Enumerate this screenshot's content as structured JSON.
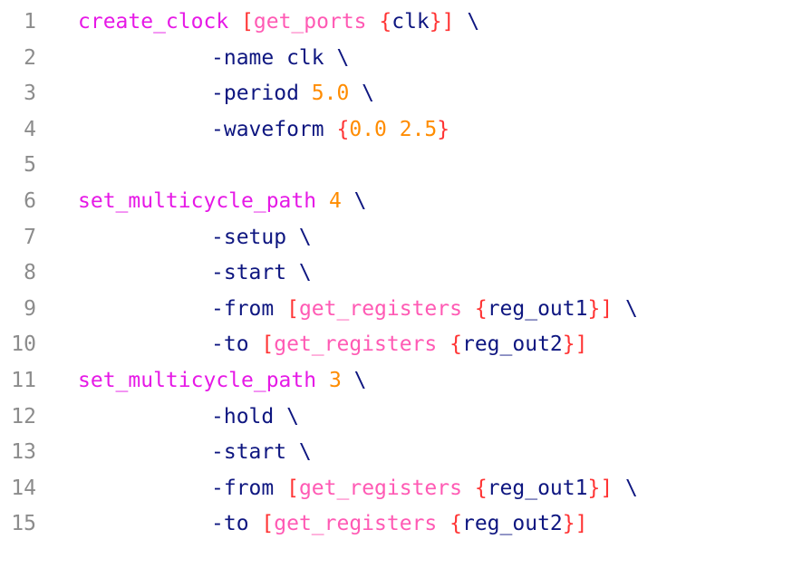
{
  "editor": {
    "lines": [
      {
        "number": "1",
        "indent": 0,
        "tokens": [
          {
            "text": "create_clock",
            "kind": "cmd"
          },
          {
            "text": " ",
            "kind": "arg"
          },
          {
            "text": "[",
            "kind": "br"
          },
          {
            "text": "get_ports",
            "kind": "fn"
          },
          {
            "text": " ",
            "kind": "arg"
          },
          {
            "text": "{",
            "kind": "br"
          },
          {
            "text": "clk",
            "kind": "arg"
          },
          {
            "text": "}",
            "kind": "br"
          },
          {
            "text": "]",
            "kind": "br"
          },
          {
            "text": " \\",
            "kind": "arg"
          }
        ]
      },
      {
        "number": "2",
        "indent": 1,
        "tokens": [
          {
            "text": "-name clk \\",
            "kind": "arg"
          }
        ]
      },
      {
        "number": "3",
        "indent": 1,
        "tokens": [
          {
            "text": "-period ",
            "kind": "arg"
          },
          {
            "text": "5.0",
            "kind": "num"
          },
          {
            "text": " \\",
            "kind": "arg"
          }
        ]
      },
      {
        "number": "4",
        "indent": 1,
        "tokens": [
          {
            "text": "-waveform ",
            "kind": "arg"
          },
          {
            "text": "{",
            "kind": "br"
          },
          {
            "text": "0.0 2.5",
            "kind": "num"
          },
          {
            "text": "}",
            "kind": "br"
          }
        ]
      },
      {
        "number": "5",
        "indent": 0,
        "tokens": []
      },
      {
        "number": "6",
        "indent": 0,
        "tokens": [
          {
            "text": "set_multicycle_path",
            "kind": "cmd"
          },
          {
            "text": " ",
            "kind": "arg"
          },
          {
            "text": "4",
            "kind": "num"
          },
          {
            "text": " \\",
            "kind": "arg"
          }
        ]
      },
      {
        "number": "7",
        "indent": 1,
        "tokens": [
          {
            "text": "-setup \\",
            "kind": "arg"
          }
        ]
      },
      {
        "number": "8",
        "indent": 1,
        "tokens": [
          {
            "text": "-start \\",
            "kind": "arg"
          }
        ]
      },
      {
        "number": "9",
        "indent": 1,
        "tokens": [
          {
            "text": "-from ",
            "kind": "arg"
          },
          {
            "text": "[",
            "kind": "br"
          },
          {
            "text": "get_registers",
            "kind": "fn"
          },
          {
            "text": " ",
            "kind": "arg"
          },
          {
            "text": "{",
            "kind": "br"
          },
          {
            "text": "reg_out1",
            "kind": "arg"
          },
          {
            "text": "}",
            "kind": "br"
          },
          {
            "text": "]",
            "kind": "br"
          },
          {
            "text": " \\",
            "kind": "arg"
          }
        ]
      },
      {
        "number": "10",
        "indent": 1,
        "tokens": [
          {
            "text": "-to ",
            "kind": "arg"
          },
          {
            "text": "[",
            "kind": "br"
          },
          {
            "text": "get_registers",
            "kind": "fn"
          },
          {
            "text": " ",
            "kind": "arg"
          },
          {
            "text": "{",
            "kind": "br"
          },
          {
            "text": "reg_out2",
            "kind": "arg"
          },
          {
            "text": "}",
            "kind": "br"
          },
          {
            "text": "]",
            "kind": "br"
          }
        ]
      },
      {
        "number": "11",
        "indent": 0,
        "tokens": [
          {
            "text": "set_multicycle_path",
            "kind": "cmd"
          },
          {
            "text": " ",
            "kind": "arg"
          },
          {
            "text": "3",
            "kind": "num"
          },
          {
            "text": " \\",
            "kind": "arg"
          }
        ]
      },
      {
        "number": "12",
        "indent": 1,
        "tokens": [
          {
            "text": "-hold \\",
            "kind": "arg"
          }
        ]
      },
      {
        "number": "13",
        "indent": 1,
        "tokens": [
          {
            "text": "-start \\",
            "kind": "arg"
          }
        ]
      },
      {
        "number": "14",
        "indent": 1,
        "tokens": [
          {
            "text": "-from ",
            "kind": "arg"
          },
          {
            "text": "[",
            "kind": "br"
          },
          {
            "text": "get_registers",
            "kind": "fn"
          },
          {
            "text": " ",
            "kind": "arg"
          },
          {
            "text": "{",
            "kind": "br"
          },
          {
            "text": "reg_out1",
            "kind": "arg"
          },
          {
            "text": "}",
            "kind": "br"
          },
          {
            "text": "]",
            "kind": "br"
          },
          {
            "text": " \\",
            "kind": "arg"
          }
        ]
      },
      {
        "number": "15",
        "indent": 1,
        "tokens": [
          {
            "text": "-to ",
            "kind": "arg"
          },
          {
            "text": "[",
            "kind": "br"
          },
          {
            "text": "get_registers",
            "kind": "fn"
          },
          {
            "text": " ",
            "kind": "arg"
          },
          {
            "text": "{",
            "kind": "br"
          },
          {
            "text": "reg_out2",
            "kind": "arg"
          },
          {
            "text": "}",
            "kind": "br"
          },
          {
            "text": "]",
            "kind": "br"
          }
        ]
      }
    ]
  },
  "colors": {
    "background": "#ffffff",
    "line_number": "#8c8c8c",
    "command": "#e619e6",
    "bracket": "#ff3333",
    "argument": "#0e1680",
    "number": "#ff8c00",
    "function": "#ff5ab4"
  }
}
